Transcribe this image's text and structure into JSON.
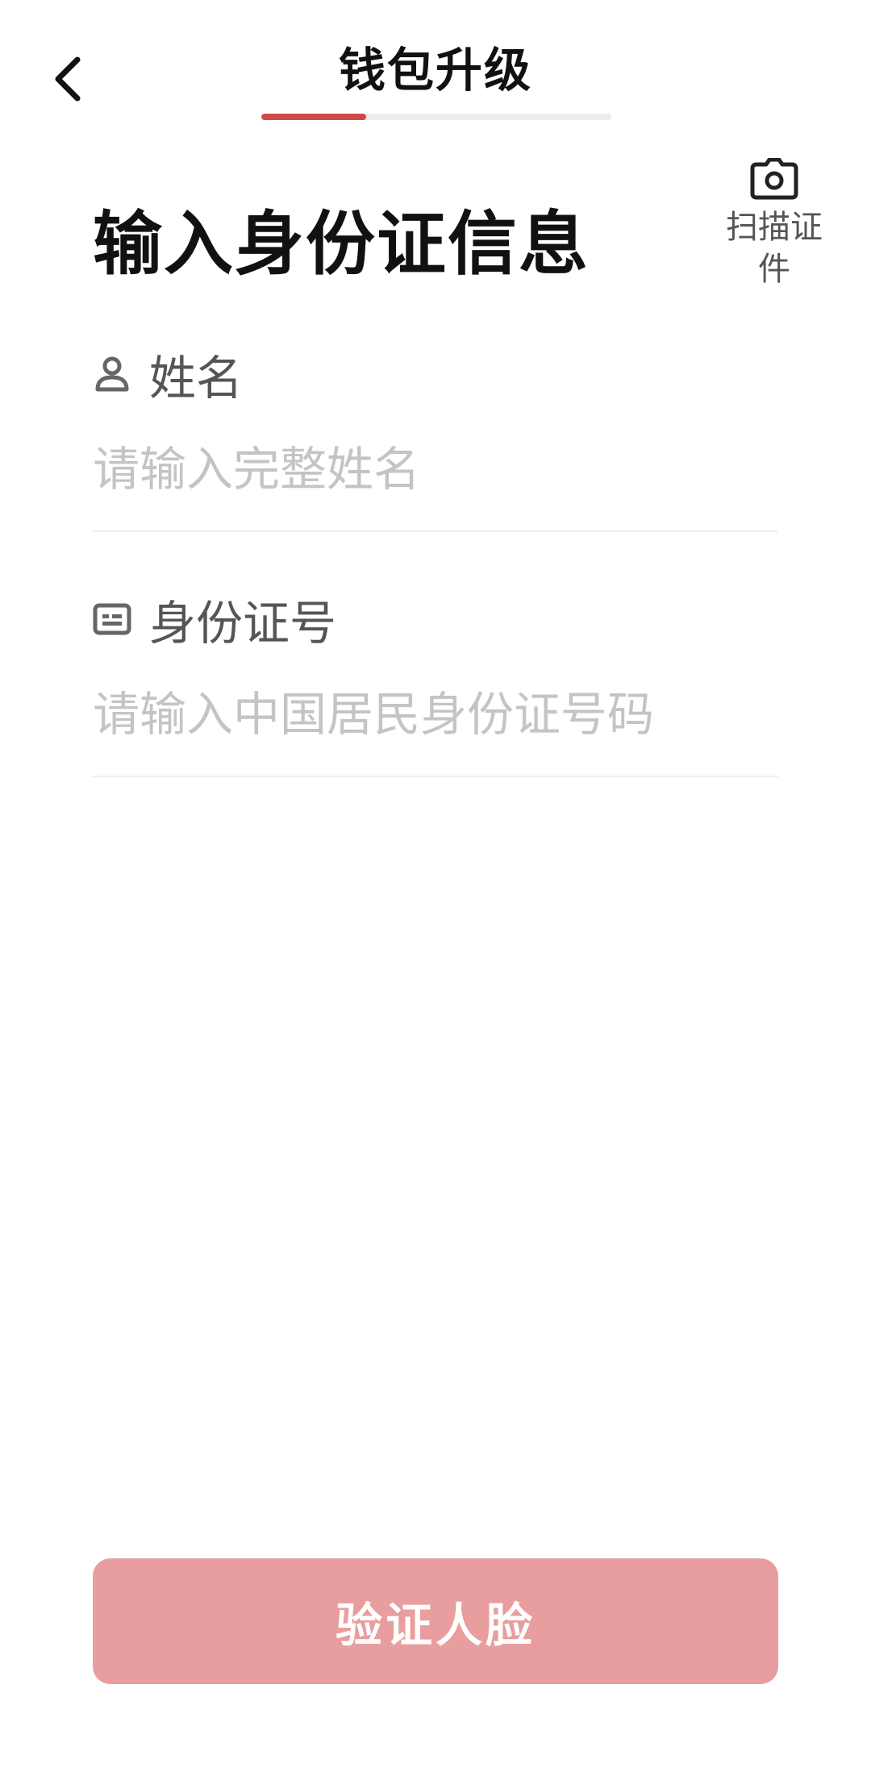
{
  "header": {
    "title": "钱包升级",
    "back_icon": "chevron-left-icon",
    "progress": 0.3,
    "progress_color": "#cf4a47"
  },
  "section": {
    "title": "输入身份证信息",
    "scan": {
      "icon": "camera-icon",
      "label": "扫描证件"
    }
  },
  "form": {
    "name": {
      "icon": "user-icon",
      "label": "姓名",
      "value": "",
      "placeholder": "请输入完整姓名"
    },
    "id_number": {
      "icon": "id-card-icon",
      "label": "身份证号",
      "value": "",
      "placeholder": "请输入中国居民身份证号码"
    }
  },
  "actions": {
    "verify_face_label": "验证人脸",
    "button_color": "#e89e9e"
  }
}
